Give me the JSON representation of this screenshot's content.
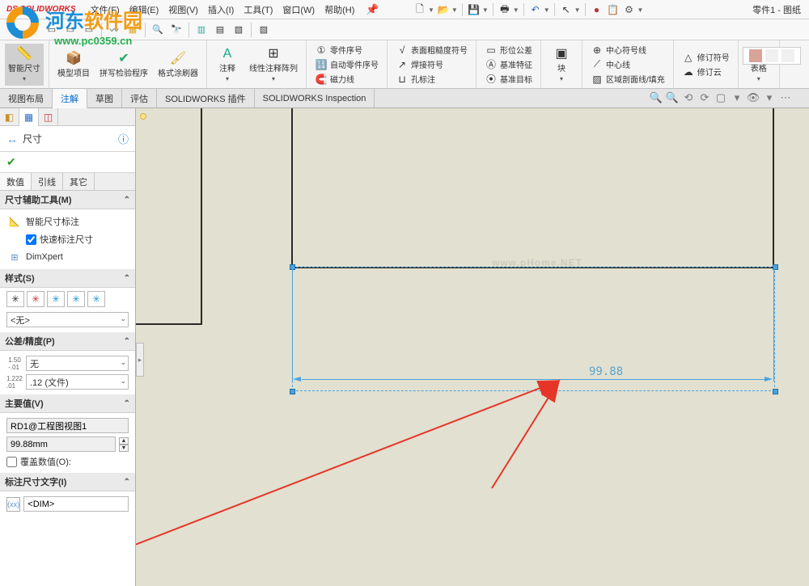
{
  "watermark": {
    "text_a": "河东",
    "text_b": "软件园",
    "url": "www.pc0359.cn",
    "canvas_mark": "www.pHome.NET"
  },
  "app": {
    "logo_text": "SOLIDWORKS",
    "doc_title": "零件1 - 图纸"
  },
  "menu": {
    "file": "文件(F)",
    "edit": "编辑(E)",
    "view": "视图(V)",
    "insert": "插入(I)",
    "tools": "工具(T)",
    "window": "窗口(W)",
    "help": "帮助(H)"
  },
  "ribbon": {
    "smart_dim": "智能尺寸",
    "model_items": "模型项目",
    "spell_check": "拼写检验程序",
    "format_painter": "格式涂刷器",
    "note": "注释",
    "linear_note_pattern": "线性注释阵列",
    "balloon": "零件序号",
    "auto_balloon": "自动零件序号",
    "magnetic_line": "磁力线",
    "surface_finish": "表面粗糙度符号",
    "weld_symbol": "焊接符号",
    "hole_callout": "孔标注",
    "geometric_tolerance": "形位公差",
    "datum_feature": "基准特征",
    "datum_target": "基准目标",
    "block": "块",
    "center_mark": "中心符号线",
    "centerline": "中心线",
    "area_hatch": "区域剖面线/填充",
    "revision_symbol": "修订符号",
    "revision_cloud": "修订云",
    "tables": "表格"
  },
  "tabs": {
    "view_layout": "视图布局",
    "annotation": "注解",
    "sketch": "草图",
    "evaluate": "评估",
    "sw_addins": "SOLIDWORKS 插件",
    "sw_inspection": "SOLIDWORKS Inspection"
  },
  "panel": {
    "title": "尺寸",
    "sub_tabs": {
      "value": "数值",
      "leaders": "引线",
      "other": "其它"
    },
    "sec_dim_assist": "尺寸辅助工具(M)",
    "smart_dim_callout": "智能尺寸标注",
    "rapid_dim": "快速标注尺寸",
    "dimxpert": "DimXpert",
    "sec_style": "样式(S)",
    "style_none": "<无>",
    "sec_tolerance": "公差/精度(P)",
    "tol_none": "无",
    "precision": ".12 (文件)",
    "sec_primary": "主要值(V)",
    "primary_name": "RD1@工程图视图1",
    "primary_value": "99.88mm",
    "override_value": "覆盖数值(O):",
    "sec_dim_text": "标注尺寸文字(I)",
    "dim_placeholder": "<DIM>"
  },
  "drawing": {
    "dimension_value": "99.88"
  }
}
